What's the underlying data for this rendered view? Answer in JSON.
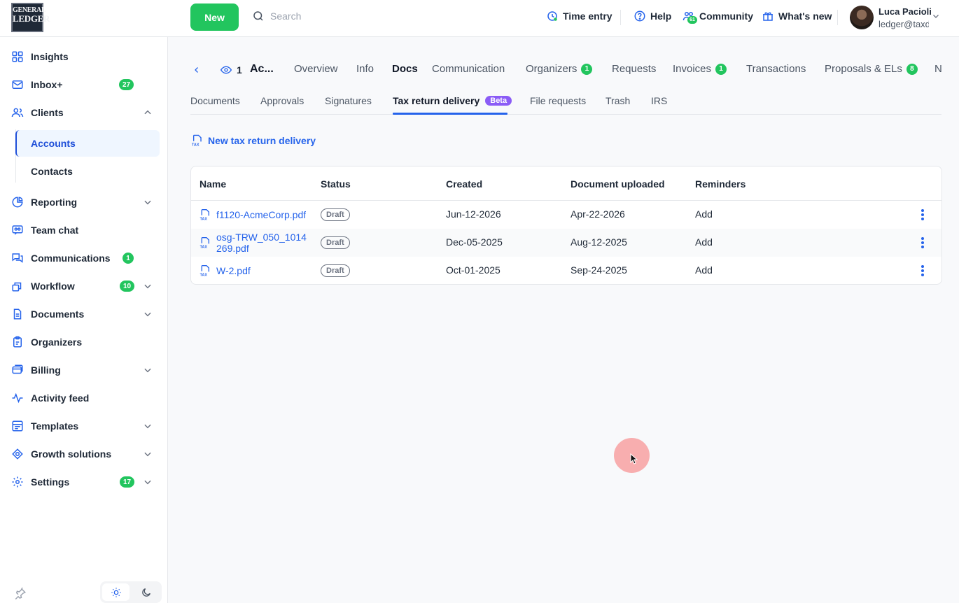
{
  "app": {
    "logo_line1": "GENERAL",
    "logo_line2": "LEDGER"
  },
  "header": {
    "new_label": "New",
    "search_placeholder": "Search",
    "time_entry": "Time entry",
    "help": "Help",
    "community": "Community",
    "community_badge": "61",
    "whats_new": "What's new",
    "user_name": "Luca Pacioli",
    "user_email": "ledger@taxdome.com"
  },
  "sidebar": {
    "items": [
      {
        "label": "Insights",
        "icon": "grid-icon"
      },
      {
        "label": "Inbox+",
        "icon": "mail-icon",
        "badge": "27"
      },
      {
        "label": "Clients",
        "icon": "users-icon"
      },
      {
        "label": "Reporting",
        "icon": "pie-chart-icon"
      },
      {
        "label": "Team chat",
        "icon": "team-chat-icon"
      },
      {
        "label": "Communications",
        "icon": "chat-bubbles-icon",
        "badge": "1"
      },
      {
        "label": "Workflow",
        "icon": "workflow-icon",
        "badge": "10"
      },
      {
        "label": "Documents",
        "icon": "document-icon"
      },
      {
        "label": "Organizers",
        "icon": "clipboard-icon"
      },
      {
        "label": "Billing",
        "icon": "billing-icon"
      },
      {
        "label": "Activity feed",
        "icon": "activity-icon"
      },
      {
        "label": "Templates",
        "icon": "templates-icon"
      },
      {
        "label": "Growth solutions",
        "icon": "growth-icon"
      },
      {
        "label": "Settings",
        "icon": "gear-icon",
        "badge": "17"
      }
    ],
    "sub_accounts": "Accounts",
    "sub_contacts": "Contacts"
  },
  "account_header": {
    "watchers": "1",
    "account_short": "Ac..."
  },
  "tabs": [
    {
      "label": "Overview"
    },
    {
      "label": "Info"
    },
    {
      "label": "Docs"
    },
    {
      "label": "Communication"
    },
    {
      "label": "Organizers",
      "badge": "1"
    },
    {
      "label": "Requests"
    },
    {
      "label": "Invoices",
      "badge": "1"
    },
    {
      "label": "Transactions"
    },
    {
      "label": "Proposals & ELs",
      "badge": "8"
    },
    {
      "label": "N"
    }
  ],
  "subtabs": [
    {
      "label": "Documents"
    },
    {
      "label": "Approvals"
    },
    {
      "label": "Signatures"
    },
    {
      "label": "Tax return delivery",
      "badge": "Beta"
    },
    {
      "label": "File requests"
    },
    {
      "label": "Trash"
    },
    {
      "label": "IRS"
    }
  ],
  "action": {
    "new_delivery": "New tax return delivery"
  },
  "table": {
    "columns": [
      "Name",
      "Status",
      "Created",
      "Document uploaded",
      "Reminders"
    ],
    "rows": [
      {
        "name": "f1120-AcmeCorp.pdf",
        "status": "Draft",
        "created": "Jun-12-2026",
        "uploaded": "Apr-22-2026",
        "reminders": "Add"
      },
      {
        "name": "osg-TRW_050_1014269.pdf",
        "status": "Draft",
        "created": "Dec-05-2025",
        "uploaded": "Aug-12-2025",
        "reminders": "Add"
      },
      {
        "name": "W-2.pdf",
        "status": "Draft",
        "created": "Oct-01-2025",
        "uploaded": "Sep-24-2025",
        "reminders": "Add"
      }
    ]
  },
  "colors": {
    "accent": "#2563eb",
    "success": "#22c55e",
    "beta": "#8b5cf6"
  }
}
